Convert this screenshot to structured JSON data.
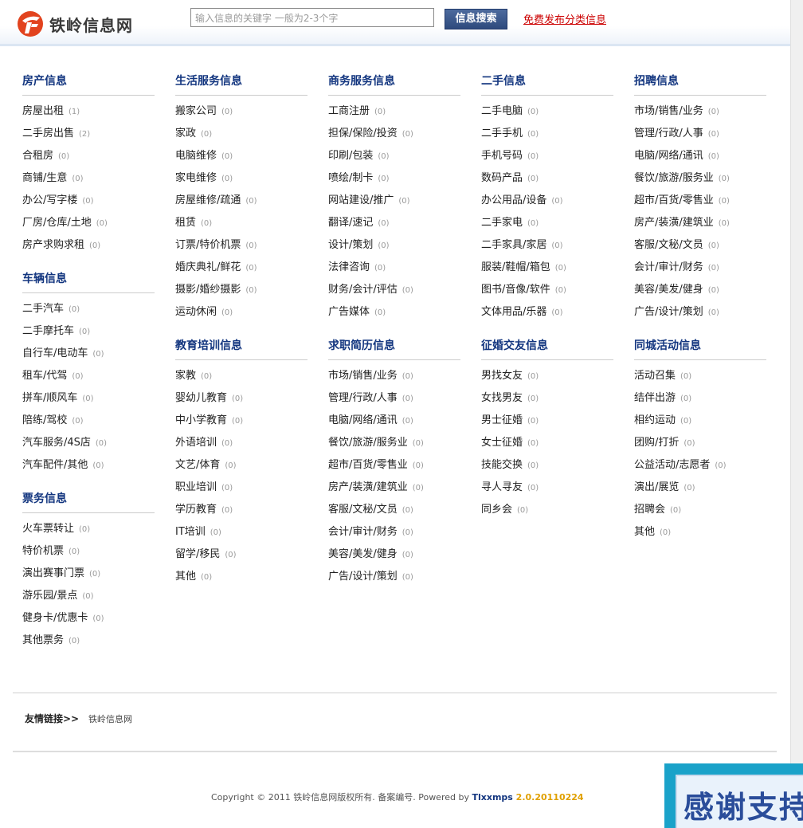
{
  "header": {
    "logo_text": "铁岭信息网",
    "search_placeholder": "输入信息的关键字 一般为2-3个字",
    "search_button": "信息搜索",
    "publish_link": "免费发布分类信息"
  },
  "columns": [
    {
      "sections": [
        {
          "title": "房产信息",
          "items": [
            {
              "label": "房屋出租",
              "count": "(1)"
            },
            {
              "label": "二手房出售",
              "count": "(2)"
            },
            {
              "label": "合租房",
              "count": "(0)"
            },
            {
              "label": "商铺/生意",
              "count": "(0)"
            },
            {
              "label": "办公/写字楼",
              "count": "(0)"
            },
            {
              "label": "厂房/仓库/土地",
              "count": "(0)"
            },
            {
              "label": "房产求购求租",
              "count": "(0)"
            }
          ]
        },
        {
          "title": "车辆信息",
          "items": [
            {
              "label": "二手汽车",
              "count": "(0)"
            },
            {
              "label": "二手摩托车",
              "count": "(0)"
            },
            {
              "label": "自行车/电动车",
              "count": "(0)"
            },
            {
              "label": "租车/代驾",
              "count": "(0)"
            },
            {
              "label": "拼车/顺风车",
              "count": "(0)"
            },
            {
              "label": "陪练/驾校",
              "count": "(0)"
            },
            {
              "label": "汽车服务/4S店",
              "count": "(0)"
            },
            {
              "label": "汽车配件/其他",
              "count": "(0)"
            }
          ]
        },
        {
          "title": "票务信息",
          "items": [
            {
              "label": "火车票转让",
              "count": "(0)"
            },
            {
              "label": "特价机票",
              "count": "(0)"
            },
            {
              "label": "演出赛事门票",
              "count": "(0)"
            },
            {
              "label": "游乐园/景点",
              "count": "(0)"
            },
            {
              "label": "健身卡/优惠卡",
              "count": "(0)"
            },
            {
              "label": "其他票务",
              "count": "(0)"
            }
          ]
        }
      ]
    },
    {
      "sections": [
        {
          "title": "生活服务信息",
          "items": [
            {
              "label": "搬家公司",
              "count": "(0)"
            },
            {
              "label": "家政",
              "count": "(0)"
            },
            {
              "label": "电脑维修",
              "count": "(0)"
            },
            {
              "label": "家电维修",
              "count": "(0)"
            },
            {
              "label": "房屋维修/疏通",
              "count": "(0)"
            },
            {
              "label": "租赁",
              "count": "(0)"
            },
            {
              "label": "订票/特价机票",
              "count": "(0)"
            },
            {
              "label": "婚庆典礼/鲜花",
              "count": "(0)"
            },
            {
              "label": "摄影/婚纱摄影",
              "count": "(0)"
            },
            {
              "label": "运动休闲",
              "count": "(0)"
            }
          ]
        },
        {
          "title": "教育培训信息",
          "items": [
            {
              "label": "家教",
              "count": "(0)"
            },
            {
              "label": "婴幼儿教育",
              "count": "(0)"
            },
            {
              "label": "中小学教育",
              "count": "(0)"
            },
            {
              "label": "外语培训",
              "count": "(0)"
            },
            {
              "label": "文艺/体育",
              "count": "(0)"
            },
            {
              "label": "职业培训",
              "count": "(0)"
            },
            {
              "label": "学历教育",
              "count": "(0)"
            },
            {
              "label": "IT培训",
              "count": "(0)"
            },
            {
              "label": "留学/移民",
              "count": "(0)"
            },
            {
              "label": "其他",
              "count": "(0)"
            }
          ]
        }
      ]
    },
    {
      "sections": [
        {
          "title": "商务服务信息",
          "items": [
            {
              "label": "工商注册",
              "count": "(0)"
            },
            {
              "label": "担保/保险/投资",
              "count": "(0)"
            },
            {
              "label": "印刷/包装",
              "count": "(0)"
            },
            {
              "label": "喷绘/制卡",
              "count": "(0)"
            },
            {
              "label": "网站建设/推广",
              "count": "(0)"
            },
            {
              "label": "翻译/速记",
              "count": "(0)"
            },
            {
              "label": "设计/策划",
              "count": "(0)"
            },
            {
              "label": "法律咨询",
              "count": "(0)"
            },
            {
              "label": "财务/会计/评估",
              "count": "(0)"
            },
            {
              "label": "广告媒体",
              "count": "(0)"
            }
          ]
        },
        {
          "title": "求职简历信息",
          "items": [
            {
              "label": "市场/销售/业务",
              "count": "(0)"
            },
            {
              "label": "管理/行政/人事",
              "count": "(0)"
            },
            {
              "label": "电脑/网络/通讯",
              "count": "(0)"
            },
            {
              "label": "餐饮/旅游/服务业",
              "count": "(0)"
            },
            {
              "label": "超市/百货/零售业",
              "count": "(0)"
            },
            {
              "label": "房产/装潢/建筑业",
              "count": "(0)"
            },
            {
              "label": "客服/文秘/文员",
              "count": "(0)"
            },
            {
              "label": "会计/审计/财务",
              "count": "(0)"
            },
            {
              "label": "美容/美发/健身",
              "count": "(0)"
            },
            {
              "label": "广告/设计/策划",
              "count": "(0)"
            }
          ]
        }
      ]
    },
    {
      "sections": [
        {
          "title": "二手信息",
          "items": [
            {
              "label": "二手电脑",
              "count": "(0)"
            },
            {
              "label": "二手手机",
              "count": "(0)"
            },
            {
              "label": "手机号码",
              "count": "(0)"
            },
            {
              "label": "数码产品",
              "count": "(0)"
            },
            {
              "label": "办公用品/设备",
              "count": "(0)"
            },
            {
              "label": "二手家电",
              "count": "(0)"
            },
            {
              "label": "二手家具/家居",
              "count": "(0)"
            },
            {
              "label": "服装/鞋帽/箱包",
              "count": "(0)"
            },
            {
              "label": "图书/音像/软件",
              "count": "(0)"
            },
            {
              "label": "文体用品/乐器",
              "count": "(0)"
            }
          ]
        },
        {
          "title": "征婚交友信息",
          "items": [
            {
              "label": "男找女友",
              "count": "(0)"
            },
            {
              "label": "女找男友",
              "count": "(0)"
            },
            {
              "label": "男士征婚",
              "count": "(0)"
            },
            {
              "label": "女士征婚",
              "count": "(0)"
            },
            {
              "label": "技能交换",
              "count": "(0)"
            },
            {
              "label": "寻人寻友",
              "count": "(0)"
            },
            {
              "label": "同乡会",
              "count": "(0)"
            }
          ]
        }
      ]
    },
    {
      "sections": [
        {
          "title": "招聘信息",
          "items": [
            {
              "label": "市场/销售/业务",
              "count": "(0)"
            },
            {
              "label": "管理/行政/人事",
              "count": "(0)"
            },
            {
              "label": "电脑/网络/通讯",
              "count": "(0)"
            },
            {
              "label": "餐饮/旅游/服务业",
              "count": "(0)"
            },
            {
              "label": "超市/百货/零售业",
              "count": "(0)"
            },
            {
              "label": "房产/装潢/建筑业",
              "count": "(0)"
            },
            {
              "label": "客服/文秘/文员",
              "count": "(0)"
            },
            {
              "label": "会计/审计/财务",
              "count": "(0)"
            },
            {
              "label": "美容/美发/健身",
              "count": "(0)"
            },
            {
              "label": "广告/设计/策划",
              "count": "(0)"
            }
          ]
        },
        {
          "title": "同城活动信息",
          "items": [
            {
              "label": "活动召集",
              "count": "(0)"
            },
            {
              "label": "结伴出游",
              "count": "(0)"
            },
            {
              "label": "相约运动",
              "count": "(0)"
            },
            {
              "label": "团购/打折",
              "count": "(0)"
            },
            {
              "label": "公益活动/志愿者",
              "count": "(0)"
            },
            {
              "label": "演出/展览",
              "count": "(0)"
            },
            {
              "label": "招聘会",
              "count": "(0)"
            },
            {
              "label": "其他",
              "count": "(0)"
            }
          ]
        }
      ]
    }
  ],
  "footer": {
    "friend_label": "友情链接>>",
    "friend_link": "铁岭信息网",
    "copyright_prefix": "Copyright © 2011 铁岭信息网版权所有. 备案编号. Powered by ",
    "brand": "Tlxxmps",
    "version": " 2.0.20110224"
  },
  "banner": {
    "text": "感谢支持"
  },
  "colors": {
    "section_title": "#12357f",
    "publish_link": "#cc0000",
    "search_button": "#2e4a7d",
    "version": "#e0a000"
  }
}
